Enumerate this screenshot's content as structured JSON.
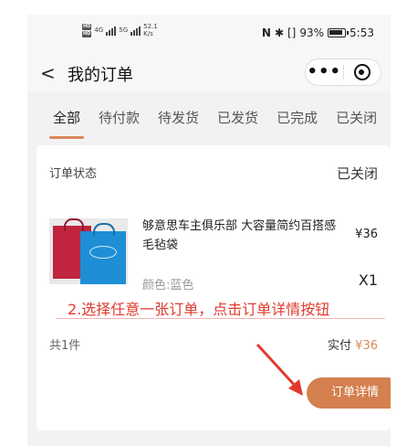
{
  "status_bar": {
    "hd1": "HD",
    "hd2": "HD",
    "net1": "4G",
    "net2": "5G",
    "speed": "52.1",
    "speed_unit": "K/s",
    "nfc": "N",
    "bluetooth": "✱",
    "vibrate": "[]",
    "battery_pct": "93%",
    "time": "5:53"
  },
  "nav": {
    "back_glyph": "<",
    "title": "我的订单",
    "more_glyph": "•••"
  },
  "tabs": [
    {
      "label": "全部",
      "active": true
    },
    {
      "label": "待付款"
    },
    {
      "label": "待发货"
    },
    {
      "label": "已发货"
    },
    {
      "label": "已完成"
    },
    {
      "label": "已关闭"
    }
  ],
  "order": {
    "status_label": "订单状态",
    "status_value": "已关闭",
    "product_name": "够意思车主俱乐部 大容量简约百搭感毛毡袋",
    "price": "¥36",
    "color_spec": "颜色:蓝色",
    "quantity": "X1",
    "item_count": "共1件",
    "paid_label": "实付",
    "paid_amount": "¥36",
    "detail_button": "订单详情"
  },
  "annotation": {
    "text": "2.选择任意一张订单，点击订单详情按钮",
    "color": "#e03a2e"
  },
  "accent_color": "#d9885a",
  "icons": [
    "back-arrow-icon",
    "more-dots-icon",
    "target-icon",
    "battery-icon",
    "signal-icon"
  ]
}
